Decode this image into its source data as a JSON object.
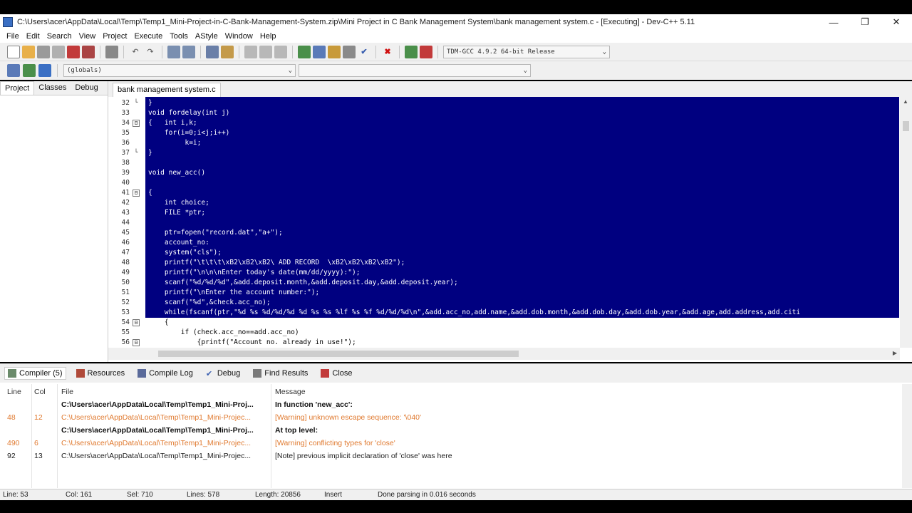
{
  "window": {
    "title": "C:\\Users\\acer\\AppData\\Local\\Temp\\Temp1_Mini-Project-in-C-Bank-Management-System.zip\\Mini Project in C Bank Management System\\bank management system.c - [Executing] - Dev-C++ 5.11",
    "minimize": "—",
    "restore": "❐",
    "close": "✕"
  },
  "menu": [
    "File",
    "Edit",
    "Search",
    "View",
    "Project",
    "Execute",
    "Tools",
    "AStyle",
    "Window",
    "Help"
  ],
  "toolbar": {
    "compiler_select": "TDM-GCC 4.9.2 64-bit Release",
    "globals_select": "(globals)",
    "function_select": ""
  },
  "left_panel": {
    "tabs": [
      "Project",
      "Classes",
      "Debug"
    ]
  },
  "editor": {
    "file_tab": "bank management system.c",
    "lines": [
      {
        "n": "32",
        "fold": "└",
        "text": "}",
        "sel": true
      },
      {
        "n": "33",
        "fold": "",
        "text": "void fordelay(int j)",
        "sel": true
      },
      {
        "n": "34",
        "fold": "⊟",
        "text": "{   int i,k;",
        "sel": true
      },
      {
        "n": "35",
        "fold": "",
        "text": "    for(i=0;i<j;i++)",
        "sel": true
      },
      {
        "n": "36",
        "fold": "",
        "text": "         k=i;",
        "sel": true
      },
      {
        "n": "37",
        "fold": "└",
        "text": "}",
        "sel": true
      },
      {
        "n": "38",
        "fold": "",
        "text": "",
        "sel": true
      },
      {
        "n": "39",
        "fold": "",
        "text": "void new_acc()",
        "sel": true
      },
      {
        "n": "40",
        "fold": "",
        "text": "",
        "sel": true
      },
      {
        "n": "41",
        "fold": "⊟",
        "text": "{",
        "sel": true
      },
      {
        "n": "42",
        "fold": "",
        "text": "    int choice;",
        "sel": true
      },
      {
        "n": "43",
        "fold": "",
        "text": "    FILE *ptr;",
        "sel": true
      },
      {
        "n": "44",
        "fold": "",
        "text": "",
        "sel": true
      },
      {
        "n": "45",
        "fold": "",
        "text": "    ptr=fopen(\"record.dat\",\"a+\");",
        "sel": true
      },
      {
        "n": "46",
        "fold": "",
        "text": "    account_no:",
        "sel": true
      },
      {
        "n": "47",
        "fold": "",
        "text": "    system(\"cls\");",
        "sel": true
      },
      {
        "n": "48",
        "fold": "",
        "text": "    printf(\"\\t\\t\\t\\xB2\\xB2\\xB2\\ ADD RECORD  \\xB2\\xB2\\xB2\\xB2\");",
        "sel": true
      },
      {
        "n": "49",
        "fold": "",
        "text": "    printf(\"\\n\\n\\nEnter today's date(mm/dd/yyyy):\");",
        "sel": true
      },
      {
        "n": "50",
        "fold": "",
        "text": "    scanf(\"%d/%d/%d\",&add.deposit.month,&add.deposit.day,&add.deposit.year);",
        "sel": true
      },
      {
        "n": "51",
        "fold": "",
        "text": "    printf(\"\\nEnter the account number:\");",
        "sel": true
      },
      {
        "n": "52",
        "fold": "",
        "text": "    scanf(\"%d\",&check.acc_no);",
        "sel": true
      },
      {
        "n": "53",
        "fold": "",
        "text": "    while(fscanf(ptr,\"%d %s %d/%d/%d %d %s %s %lf %s %f %d/%d/%d\\n\",&add.acc_no,add.name,&add.dob.month,&add.dob.day,&add.dob.year,&add.age,add.address,add.citi",
        "sel": true
      },
      {
        "n": "54",
        "fold": "⊟",
        "text": "    {",
        "sel": false
      },
      {
        "n": "55",
        "fold": "",
        "text": "        if (check.acc_no==add.acc_no)",
        "sel": false
      },
      {
        "n": "56",
        "fold": "⊟",
        "text": "            {printf(\"Account no. already in use!\");",
        "sel": false
      }
    ]
  },
  "bottom_tabs": [
    "Compiler (5)",
    "Resources",
    "Compile Log",
    "Debug",
    "Find Results",
    "Close"
  ],
  "messages": {
    "headers": {
      "line": "Line",
      "col": "Col",
      "file": "File",
      "message": "Message"
    },
    "rows": [
      {
        "line": "",
        "col": "",
        "file": "C:\\Users\\acer\\AppData\\Local\\Temp\\Temp1_Mini-Proj...",
        "message": "In function 'new_acc':",
        "kind": "bold"
      },
      {
        "line": "48",
        "col": "12",
        "file": "C:\\Users\\acer\\AppData\\Local\\Temp\\Temp1_Mini-Projec...",
        "message": "[Warning] unknown escape sequence: '\\040'",
        "kind": "warn"
      },
      {
        "line": "",
        "col": "",
        "file": "C:\\Users\\acer\\AppData\\Local\\Temp\\Temp1_Mini-Proj...",
        "message": "At top level:",
        "kind": "bold"
      },
      {
        "line": "490",
        "col": "6",
        "file": "C:\\Users\\acer\\AppData\\Local\\Temp\\Temp1_Mini-Projec...",
        "message": "[Warning] conflicting types for 'close'",
        "kind": "warn"
      },
      {
        "line": "92",
        "col": "13",
        "file": "C:\\Users\\acer\\AppData\\Local\\Temp\\Temp1_Mini-Projec...",
        "message": "[Note] previous implicit declaration of 'close' was here",
        "kind": "note"
      }
    ]
  },
  "status": {
    "line": "Line:   53",
    "col": "Col:   161",
    "sel": "Sel:   710",
    "lines": "Lines:   578",
    "length": "Length: 20856",
    "mode": "Insert",
    "parse": "Done parsing in 0.016 seconds"
  },
  "colors": {
    "selection": "#000080",
    "warning": "#e07a30",
    "string": "#ff2020"
  }
}
